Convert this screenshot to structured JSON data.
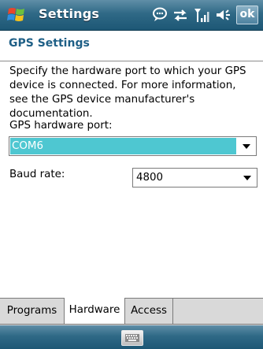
{
  "titlebar": {
    "title": "Settings",
    "ok_label": "ok",
    "icons": [
      "windows-start-icon",
      "notification-bubble-icon",
      "connectivity-arrows-icon",
      "signal-strength-icon",
      "volume-icon"
    ]
  },
  "page": {
    "title": "GPS Settings",
    "description": "Specify the hardware port to which your GPS device is connected. For more information, see the GPS device manufacturer's documentation."
  },
  "form": {
    "port_label": "GPS hardware port:",
    "port_value": "COM6",
    "baud_label": "Baud rate:",
    "baud_value": "4800"
  },
  "tabs": [
    {
      "label": "Programs",
      "active": false
    },
    {
      "label": "Hardware",
      "active": true
    },
    {
      "label": "Access",
      "active": false
    }
  ],
  "colors": {
    "titlebar": "#2f6986",
    "page_title": "#1e5f86",
    "selection": "#4ec7d1"
  }
}
